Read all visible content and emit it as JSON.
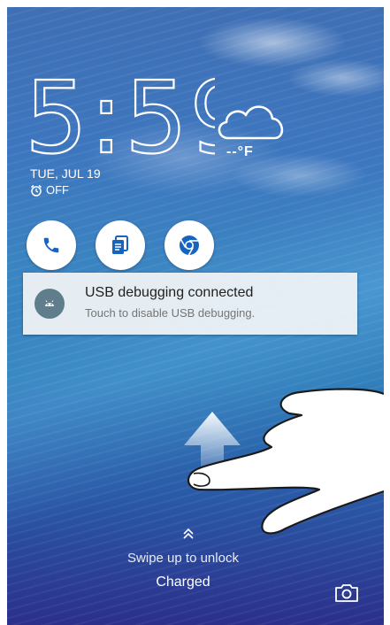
{
  "lockscreen": {
    "time": "5:59",
    "temperature": "--°F",
    "date": "TUE, JUL 19",
    "alarm": "OFF",
    "swipe_hint": "Swipe up to unlock",
    "battery_status": "Charged"
  },
  "shortcuts": [
    {
      "icon": "phone-icon"
    },
    {
      "icon": "memo-icon"
    },
    {
      "icon": "chrome-icon"
    }
  ],
  "notification": {
    "title": "USB debugging connected",
    "text": "Touch to disable USB debugging.",
    "icon": "android-debug-icon"
  },
  "colors": {
    "shortcut_icon": "#1565c0",
    "notification_bg": "#eef2f6",
    "notification_icon_bg": "#607d8b"
  }
}
